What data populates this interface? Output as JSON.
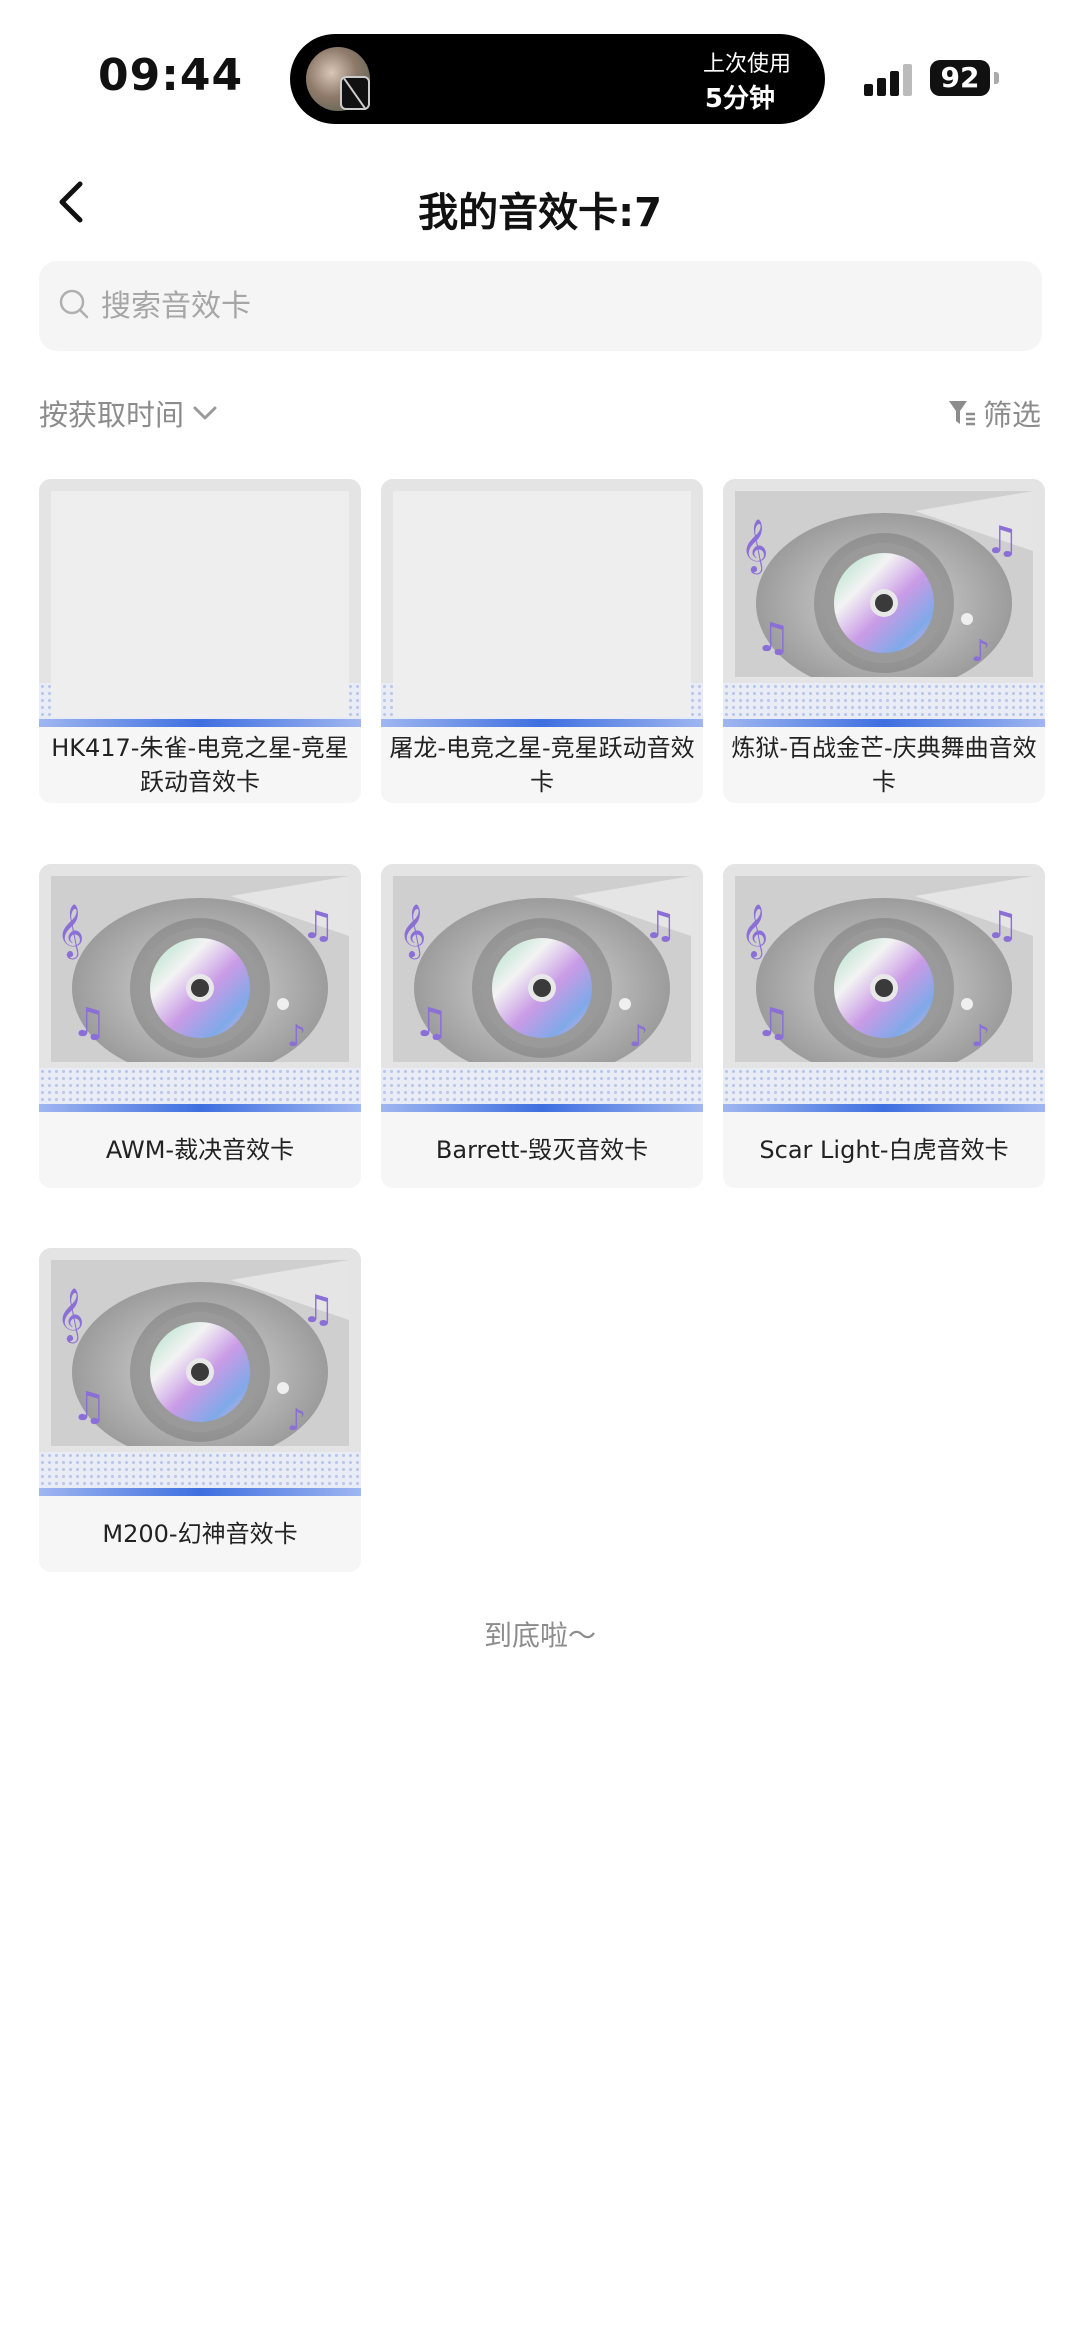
{
  "status": {
    "time": "09:44",
    "battery": "92",
    "island_line1": "上次使用",
    "island_line2": "5分钟"
  },
  "header": {
    "title": "我的音效卡:7"
  },
  "search": {
    "placeholder": "搜索音效卡"
  },
  "toolbar": {
    "sort_label": "按获取时间",
    "filter_label": "筛选"
  },
  "cards": [
    {
      "label": "HK417-朱雀-电竞之星-竞星跃动音效卡",
      "image": "blank"
    },
    {
      "label": "屠龙-电竞之星-竞星跃动音效卡",
      "image": "blank"
    },
    {
      "label": "炼狱-百战金芒-庆典舞曲音效卡",
      "image": "cd"
    },
    {
      "label": "AWM-裁决音效卡",
      "image": "cd"
    },
    {
      "label": "Barrett-毁灭音效卡",
      "image": "cd"
    },
    {
      "label": "Scar Light-白虎音效卡",
      "image": "cd"
    },
    {
      "label": "M200-幻神音效卡",
      "image": "cd"
    }
  ],
  "footer": {
    "end_text": "到底啦～"
  },
  "colors": {
    "accent_blue": "#3e6fe0",
    "cd_purple": "#8b6fd6",
    "muted_text": "#8c8c8c"
  }
}
